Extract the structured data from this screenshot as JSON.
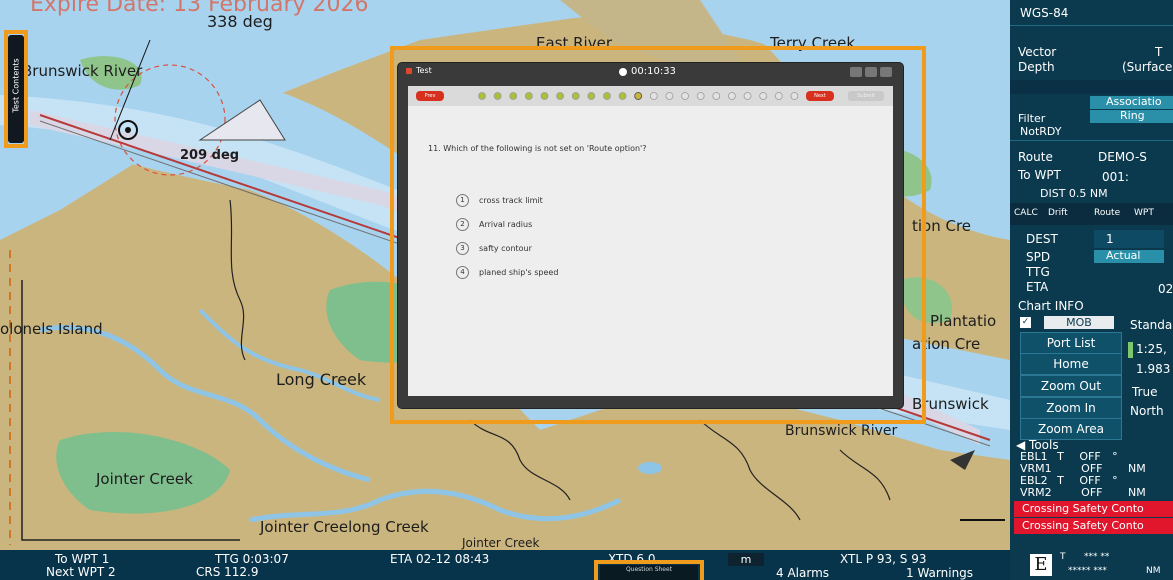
{
  "map": {
    "watermark": "Expire Date: 13 February 2026",
    "heading": "338 deg",
    "labels": {
      "brunswick_river": "Brunswick River",
      "east_river": "East River",
      "terry_creek": "Terry Creek",
      "colonels_island": "olonels Island",
      "long_creek": "Long Creek",
      "jointer_creek": "Jointer Creek",
      "jointer_creek_long": "Jointer Creelong Creek",
      "jointer_creek_bottom": "Jointer Creek",
      "brunswick_river_lower": "Brunswick River",
      "plantation_1": "tion Cre",
      "plantation_2": "Plantatio",
      "plantation_3": "ation Cre",
      "brunswick": "Brunswick",
      "range_label": "209 deg"
    },
    "side_tab": "Test Contents"
  },
  "dialog": {
    "title": "Test",
    "timer": "00:10:33",
    "prev_label": "Prev",
    "next_label": "Next",
    "submit_label": "Submit",
    "question": "11.  Which of the following is not set on 'Route option'?",
    "options": [
      {
        "num": "1",
        "text": "cross track limit"
      },
      {
        "num": "2",
        "text": "Arrival radius"
      },
      {
        "num": "3",
        "text": "safty contour"
      },
      {
        "num": "4",
        "text": "planed ship's speed"
      }
    ],
    "progress": {
      "answered": 10,
      "current": 11,
      "total": 22
    },
    "colors": {
      "answered": "#a6c23a",
      "current": "#c9b53a",
      "pending": "#e2e2e2",
      "nav_red": "#d8301e"
    }
  },
  "panel": {
    "datum": "WGS-84",
    "vector_label": "Vector",
    "vector_value": "T",
    "depth_label": "Depth",
    "depth_value": "(Surface",
    "association_label": "Associatio",
    "filter_label": "Filter",
    "ring_label": "Ring",
    "notrdy": "NotRDY",
    "route_label": "Route",
    "route_value": "DEMO-S",
    "to_wpt_label": "To WPT",
    "to_wpt_value": "001:",
    "dist": "DIST 0.5 NM",
    "calc_tabs": [
      "CALC",
      "Drift",
      "Route",
      "WPT"
    ],
    "dest_label": "DEST",
    "dest_value": "1",
    "spd_label": "SPD",
    "spd_value": "Actual",
    "ttg_label": "TTG",
    "eta_label": "ETA",
    "eta_value": "02",
    "chart_info_label": "Chart INFO",
    "mob_label": "MOB",
    "standard_label": "Standa",
    "port_list_label": "Port List",
    "home_label": "Home",
    "zoom_out_label": "Zoom Out",
    "zoom_in_label": "Zoom In",
    "zoom_area_label": "Zoom Area",
    "scale_1": "1:25,",
    "scale_2": "1.983",
    "true_label": "True",
    "north_label": "North",
    "tools_label": "Tools",
    "tools": [
      {
        "name": "EBL1",
        "mode": "T",
        "state": "OFF",
        "unit": "°"
      },
      {
        "name": "VRM1",
        "mode": "",
        "state": "OFF",
        "unit": "NM"
      },
      {
        "name": "EBL2",
        "mode": "T",
        "state": "OFF",
        "unit": "°"
      },
      {
        "name": "VRM2",
        "mode": "",
        "state": "OFF",
        "unit": "NM"
      }
    ],
    "alert_1": "Crossing Safety Conto",
    "alert_2": "Crossing Safety Conto",
    "e_label": "E",
    "bottom_t": "T",
    "bottom_stars_1": "*** **",
    "bottom_stars_2": "***** ***",
    "bottom_nm": "NM"
  },
  "statusbar": {
    "to_wpt": "To WPT 1",
    "next_wpt": "Next WPT 2",
    "ttg": "TTG 0:03:07",
    "crs": "CRS 112.9",
    "eta": "ETA 02-12 08:43",
    "xtd": "XTD 6.0",
    "unit": "m",
    "xtl": "XTL P 93, S 93",
    "alarms": "4 Alarms",
    "warnings": "1 Warnings",
    "center_button": "Question Sheet"
  }
}
